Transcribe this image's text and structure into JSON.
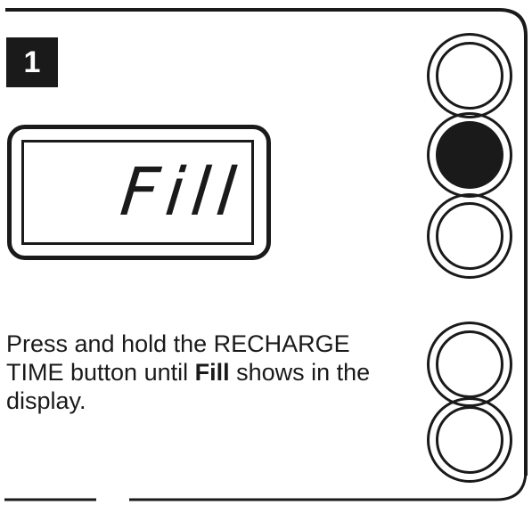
{
  "step": {
    "number": "1"
  },
  "display": {
    "text": "Fill"
  },
  "instruction": {
    "before": "Press and hold the RECHARGE TIME button until ",
    "emphasis": "Fill",
    "after": " shows in the display."
  },
  "buttons": [
    {
      "state": "unpressed"
    },
    {
      "state": "pressed"
    },
    {
      "state": "unpressed"
    },
    {
      "state": "unpressed"
    },
    {
      "state": "unpressed"
    }
  ],
  "colors": {
    "ink": "#1a1a1a",
    "background": "#ffffff"
  }
}
